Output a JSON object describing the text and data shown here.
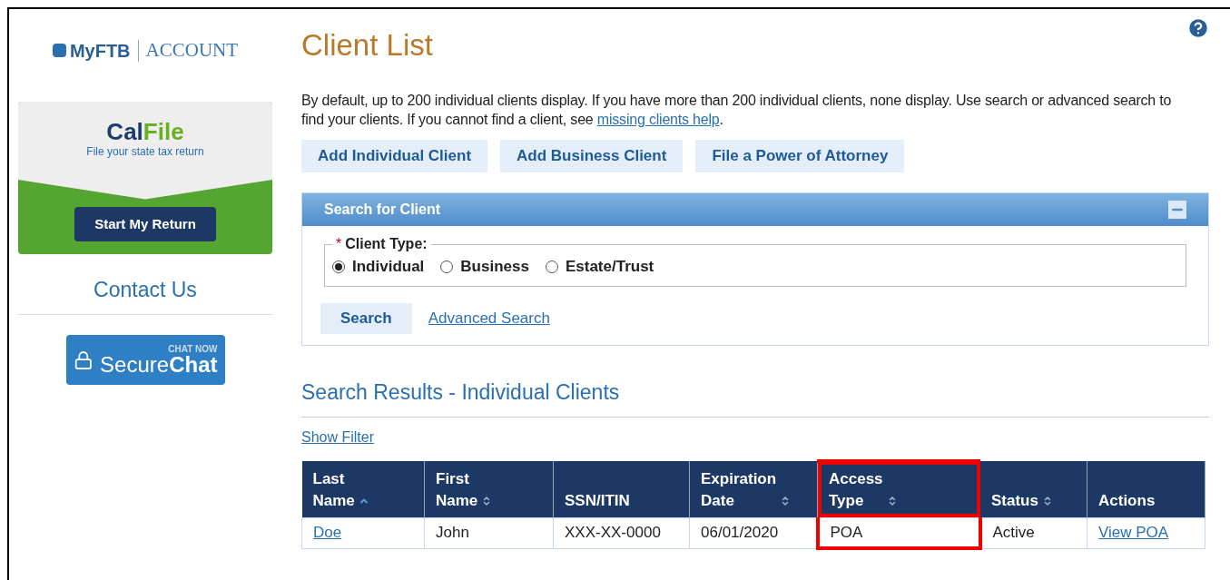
{
  "logo": {
    "brand": "MyFTB",
    "section": "ACCOUNT"
  },
  "calfile": {
    "name_part1": "Cal",
    "name_part2": "File",
    "tagline": "File your state tax return",
    "button": "Start My Return"
  },
  "sidebar": {
    "contact": "Contact Us",
    "chat": {
      "top": "CHAT NOW",
      "word1": "Secure",
      "word2": "Chat"
    }
  },
  "page_title": "Client List",
  "intro": {
    "text": "By default, up to 200 individual clients display. If you have more than 200 individual clients, none display. Use search or advanced search to find your clients. If you cannot find a client, see ",
    "link": "missing clients help",
    "end": "."
  },
  "actions": [
    "Add Individual Client",
    "Add Business Client",
    "File a Power of Attorney"
  ],
  "search_panel": {
    "title": "Search for Client",
    "expanded": true,
    "legend": "Client Type:",
    "required_mark": "*",
    "options": [
      {
        "label": "Individual",
        "selected": true
      },
      {
        "label": "Business",
        "selected": false
      },
      {
        "label": "Estate/Trust",
        "selected": false
      }
    ],
    "search_button": "Search",
    "advanced_link": "Advanced Search"
  },
  "results": {
    "heading": "Search Results - Individual Clients",
    "filter_link": "Show Filter",
    "columns": [
      {
        "label": "Last Name",
        "sortable": true,
        "sorted": true,
        "highlighted": false
      },
      {
        "label": "First Name",
        "sortable": true,
        "sorted": false,
        "highlighted": false
      },
      {
        "label": "SSN/ITIN",
        "sortable": false,
        "sorted": false,
        "highlighted": false
      },
      {
        "label": "Expiration Date",
        "sortable": true,
        "sorted": false,
        "highlighted": false
      },
      {
        "label": "Access Type",
        "sortable": true,
        "sorted": false,
        "highlighted": true
      },
      {
        "label": "Status",
        "sortable": true,
        "sorted": false,
        "highlighted": false
      },
      {
        "label": "Actions",
        "sortable": false,
        "sorted": false,
        "highlighted": false
      }
    ],
    "rows": [
      {
        "cells": [
          {
            "text": "Doe",
            "kind": "link"
          },
          {
            "text": "John",
            "kind": "text"
          },
          {
            "text": "XXX-XX-0000",
            "kind": "text"
          },
          {
            "text": "06/01/2020",
            "kind": "text"
          },
          {
            "text": "POA",
            "kind": "text"
          },
          {
            "text": "Active",
            "kind": "text"
          },
          {
            "text": "View POA",
            "kind": "link"
          }
        ]
      }
    ]
  }
}
